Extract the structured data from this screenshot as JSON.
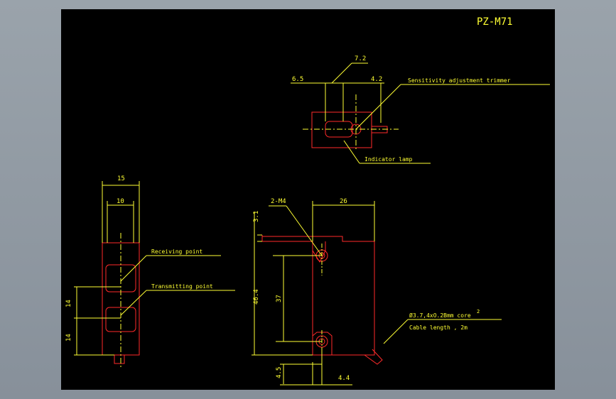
{
  "title": "PZ-M71",
  "colors": {
    "background": "#000000",
    "outline": "#ff2a2a",
    "dimension": "#ffff33",
    "frame": "#8d969e"
  },
  "top_view": {
    "dims": {
      "d1": "6.5",
      "d2": "7.2",
      "d3": "4.2"
    },
    "labels": {
      "trimmer": "Sensitivity adjustment trimmer",
      "lamp": "Indicator lamp"
    }
  },
  "front_view": {
    "dims": {
      "width_outer": "15",
      "width_inner": "10",
      "h1": "14",
      "h2": "14"
    },
    "labels": {
      "receiving": "Receiving point",
      "transmitting": "Transmitting point"
    }
  },
  "side_view": {
    "dims": {
      "screw": "2-M4",
      "width": "26",
      "top": "3.1",
      "height": "46.4",
      "pitch": "37",
      "bottom": "4.5",
      "offset": "4.4"
    },
    "labels": {
      "cable": "Ø3.7,4xO.2Bmm core",
      "cable_mark": "2",
      "cable_length": "Cable length ,  2m"
    }
  }
}
